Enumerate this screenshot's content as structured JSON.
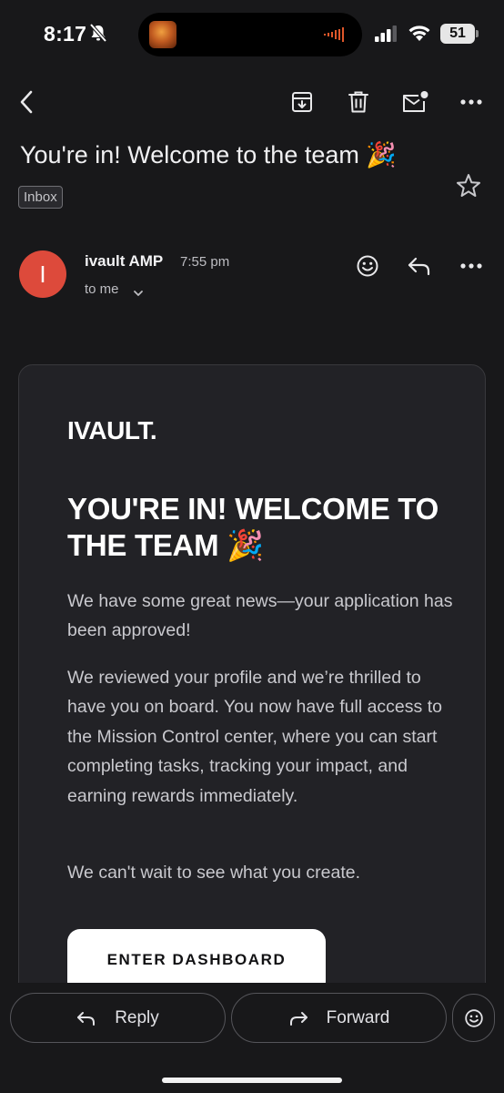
{
  "status_bar": {
    "time": "8:17",
    "battery": "51"
  },
  "toolbar": {
    "back_icon": "chevron-left-icon",
    "archive_icon": "archive-icon",
    "delete_icon": "trash-icon",
    "mark_unread_icon": "mail-unread-icon",
    "more_icon": "more-horizontal-icon"
  },
  "subject": {
    "text": "You're in! Welcome to the team 🎉",
    "label_chip": "Inbox"
  },
  "sender": {
    "avatar_initial": "I",
    "avatar_color": "#dd4a3b",
    "name": "ivault AMP",
    "time": "7:55 pm",
    "recipient": "to me"
  },
  "email_body": {
    "brand": "IVAULT.",
    "headline": "YOU'RE IN! WELCOME TO THE TEAM 🎉",
    "paragraph_1": "We have some great news—your application has been approved!",
    "paragraph_2": "We reviewed your profile and we’re thrilled to have you on board. You now have full access to the Mission Control center, where you can start completing tasks, tracking your impact, and earning rewards immediately.",
    "paragraph_3": "We can't wait to see what you create.",
    "cta_label": "ENTER DASHBOARD"
  },
  "bottom_bar": {
    "reply_label": "Reply",
    "forward_label": "Forward"
  },
  "colors": {
    "background": "#18181a",
    "card": "#222226",
    "accent_avatar": "#dd4a3b",
    "cta_bg": "#ffffff"
  }
}
